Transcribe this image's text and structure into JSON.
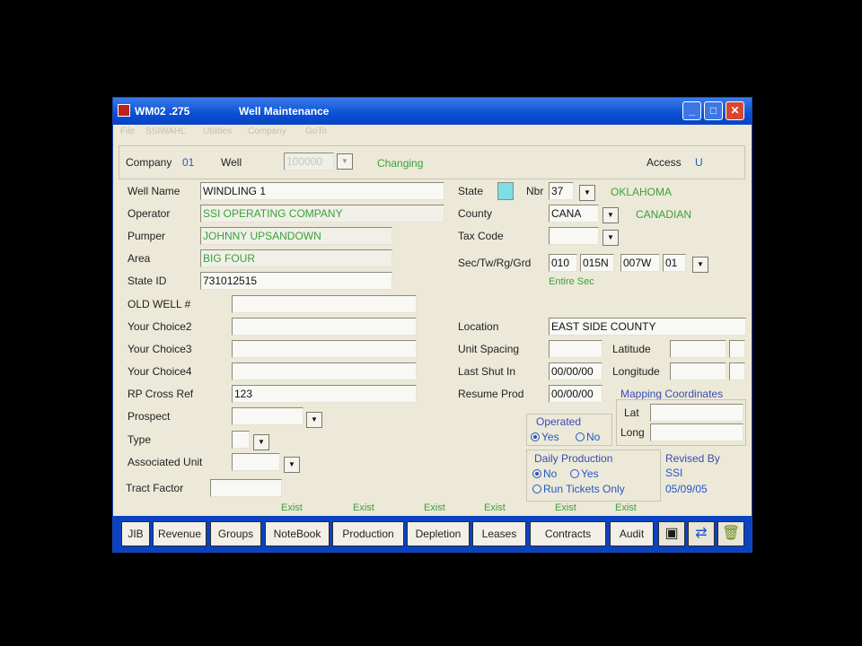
{
  "window": {
    "code": "WM02 .275",
    "title": "Well Maintenance",
    "buttons": {
      "minimize": "_",
      "maximize": "□",
      "close": "✕"
    }
  },
  "menu": [
    "File",
    "SSIWAHL",
    "Utilities",
    "Company",
    "GoTo"
  ],
  "header": {
    "company_label": "Company",
    "company_value": "01",
    "well_label": "Well",
    "well_value": "100000",
    "status": "Changing",
    "access_label": "Access",
    "access_value": "U"
  },
  "left": {
    "well_name_label": "Well Name",
    "well_name": "WINDLING 1",
    "operator_label": "Operator",
    "operator": "SSI OPERATING COMPANY",
    "pumper_label": "Pumper",
    "pumper": "JOHNNY UPSANDOWN",
    "area_label": "Area",
    "area": "BIG FOUR",
    "state_id_label": "State ID",
    "state_id": "731012515",
    "old_well_label": "OLD WELL #",
    "old_well": "",
    "choice2_label": "Your Choice2",
    "choice2": "",
    "choice3_label": "Your Choice3",
    "choice3": "",
    "choice4_label": "Your Choice4",
    "choice4": "",
    "rp_label": "RP Cross Ref",
    "rp": "123",
    "prospect_label": "Prospect",
    "prospect": "",
    "type_label": "Type",
    "type": "",
    "assoc_label": "Associated Unit",
    "assoc": "",
    "tract_label": "Tract Factor",
    "tract": ""
  },
  "right": {
    "state_label": "State",
    "nbr_label": "Nbr",
    "nbr": "37",
    "state_name": "OKLAHOMA",
    "county_label": "County",
    "county": "CANA",
    "county_name": "CANADIAN",
    "tax_label": "Tax Code",
    "tax": "",
    "strg_label": "Sec/Tw/Rg/Grd",
    "sec": "010",
    "tw": "015N",
    "rg": "007W",
    "grd": "01",
    "entire_sec": "Entire Sec",
    "location_label": "Location",
    "location": "EAST SIDE COUNTY",
    "unit_spacing_label": "Unit Spacing",
    "unit_spacing": "",
    "last_shut_label": "Last Shut In",
    "last_shut": "00/00/00",
    "resume_label": "Resume Prod",
    "resume": "00/00/00",
    "latitude_label": "Latitude",
    "longitude_label": "Longitude",
    "mapping_title": "Mapping Coordinates",
    "lat_label": "Lat",
    "long_label": "Long",
    "operated_title": "Operated",
    "yes": "Yes",
    "no": "No",
    "daily_title": "Daily Production",
    "run_tickets": "Run Tickets Only",
    "revised_title": "Revised By",
    "revised_by": "SSI",
    "revised_date": "05/09/05"
  },
  "exist_label": "Exist",
  "toolbar": {
    "jib": "JIB",
    "revenue": "Revenue",
    "groups": "Groups",
    "notebook": "NoteBook",
    "production": "Production",
    "depletion": "Depletion",
    "leases": "Leases",
    "contracts": "Contracts",
    "audit": "Audit"
  },
  "colors": {
    "titlebar": "#0a4fd4",
    "toolbar": "#0b42c2",
    "green_text": "#3ca03c",
    "blue_text": "#2457c5"
  }
}
